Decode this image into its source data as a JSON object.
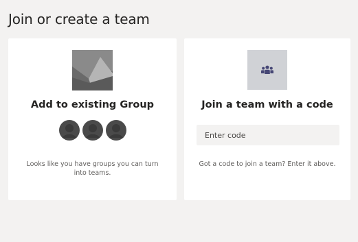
{
  "page": {
    "title": "Join or create a team"
  },
  "existing_group_card": {
    "title": "Add to existing Group",
    "description": "Looks like you have groups you can turn into teams.",
    "image_icon": "landscape-placeholder-icon",
    "avatar_icon": "person-avatar-icon",
    "avatar_count": 3
  },
  "join_code_card": {
    "title": "Join a team with a code",
    "icon": "people-group-icon",
    "input_placeholder": "Enter code",
    "input_value": "",
    "description": "Got a code to join a team? Enter it above."
  },
  "colors": {
    "page_background": "#f3f2f1",
    "card_background": "#ffffff",
    "tile_background": "#d0d2d6",
    "icon_dark": "#464775",
    "avatar": "#4a4a4a"
  }
}
